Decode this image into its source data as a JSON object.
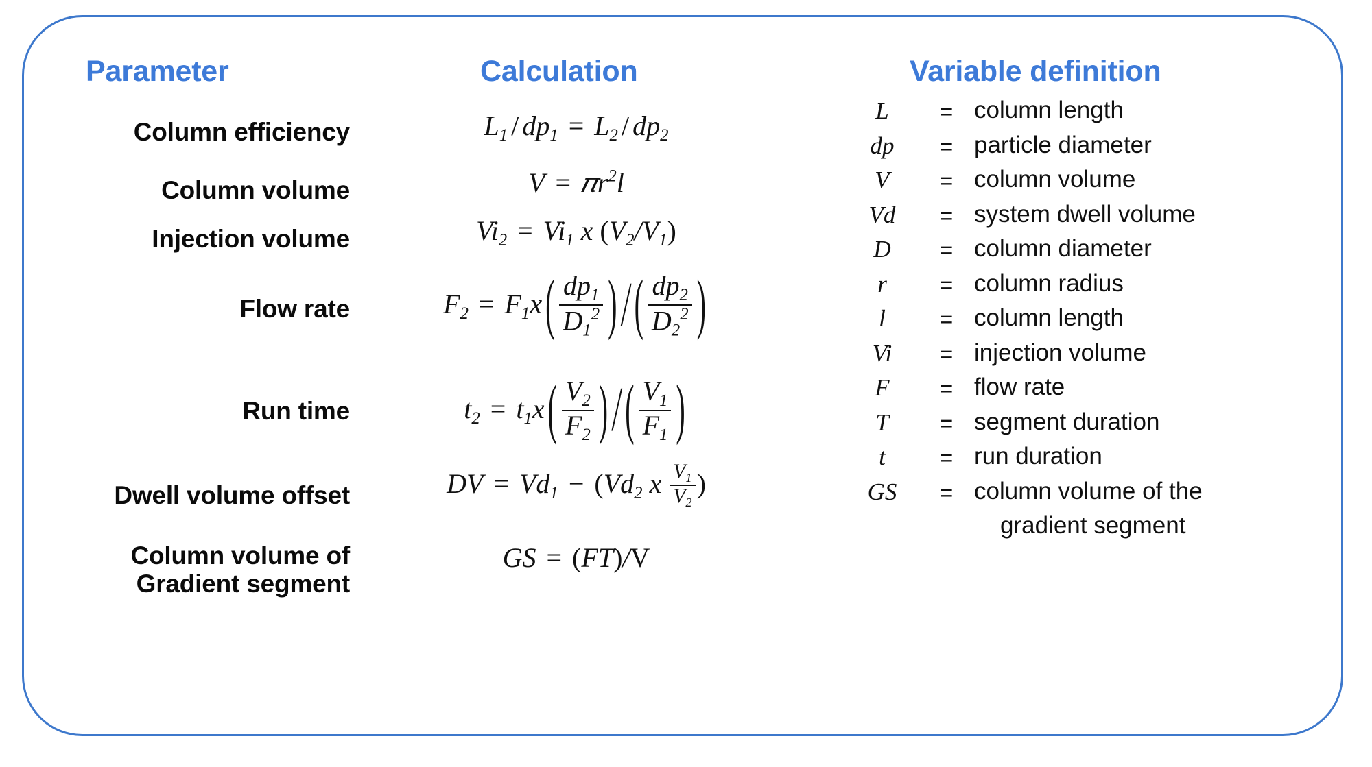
{
  "frame": {
    "border_color": "#3d78cc",
    "accent_color": "#3d7ad8"
  },
  "headers": {
    "parameter": "Parameter",
    "calculation": "Calculation",
    "variable_definition": "Variable definition"
  },
  "rows": [
    {
      "parameter": "Column efficiency",
      "formula_text": "L1/dp1 = L2/dp2"
    },
    {
      "parameter": "Column volume",
      "formula_text": "V = πr²l"
    },
    {
      "parameter": "Injection volume",
      "formula_text": "Vi2 = Vi1 x (V2/V1)"
    },
    {
      "parameter": "Flow rate",
      "formula_text": "F2 = F1x (dp1/D1²)/(dp2/D2²)"
    },
    {
      "parameter": "Run time",
      "formula_text": "t2 = t1x (V2/F2)/(V1/F1)"
    },
    {
      "parameter": "Dwell volume offset",
      "formula_text": "DV = Vd1 − (Vd2 x V1/V2)"
    },
    {
      "parameter": "Column volume of\nGradient segment",
      "formula_text": "GS = (FT)/V"
    }
  ],
  "parameters": {
    "column_efficiency": "Column efficiency",
    "column_volume": "Column volume",
    "injection_volume": "Injection volume",
    "flow_rate": "Flow rate",
    "run_time": "Run time",
    "dwell_volume_offset": "Dwell volume offset",
    "gradient_segment_volume": "Column volume of\nGradient segment"
  },
  "formula_symbols": {
    "L": "L",
    "dp": "dp",
    "V": "V",
    "Vi": "Vi",
    "Vd": "Vd",
    "D": "D",
    "F": "F",
    "t": "t",
    "DV": "DV",
    "GS": "GS",
    "FT": "FT",
    "pi_r2_l": "πr",
    "one": "1",
    "two": "2",
    "eq": "=",
    "div": "/",
    "mult": "x",
    "minus": "−",
    "lparen": "(",
    "rparen": ")",
    "sup2": "2"
  },
  "variables": [
    {
      "symbol": "L",
      "eq": "=",
      "definition": "column length"
    },
    {
      "symbol": "dp",
      "eq": "=",
      "definition": "particle diameter"
    },
    {
      "symbol": "V",
      "eq": "=",
      "definition": "column volume"
    },
    {
      "symbol": "Vd",
      "eq": "=",
      "definition": "system dwell volume"
    },
    {
      "symbol": "D",
      "eq": "=",
      "definition": "column diameter"
    },
    {
      "symbol": "r",
      "eq": "=",
      "definition": "column radius"
    },
    {
      "symbol": "l",
      "eq": "=",
      "definition": "column length"
    },
    {
      "symbol": "Vi",
      "eq": "=",
      "definition": "injection volume"
    },
    {
      "symbol": "F",
      "eq": "=",
      "definition": "flow rate"
    },
    {
      "symbol": "T",
      "eq": "=",
      "definition": "segment duration"
    },
    {
      "symbol": "t",
      "eq": "=",
      "definition": "run duration"
    },
    {
      "symbol": "GS",
      "eq": "=",
      "definition": "column volume of the",
      "definition_line2": "gradient segment"
    }
  ]
}
